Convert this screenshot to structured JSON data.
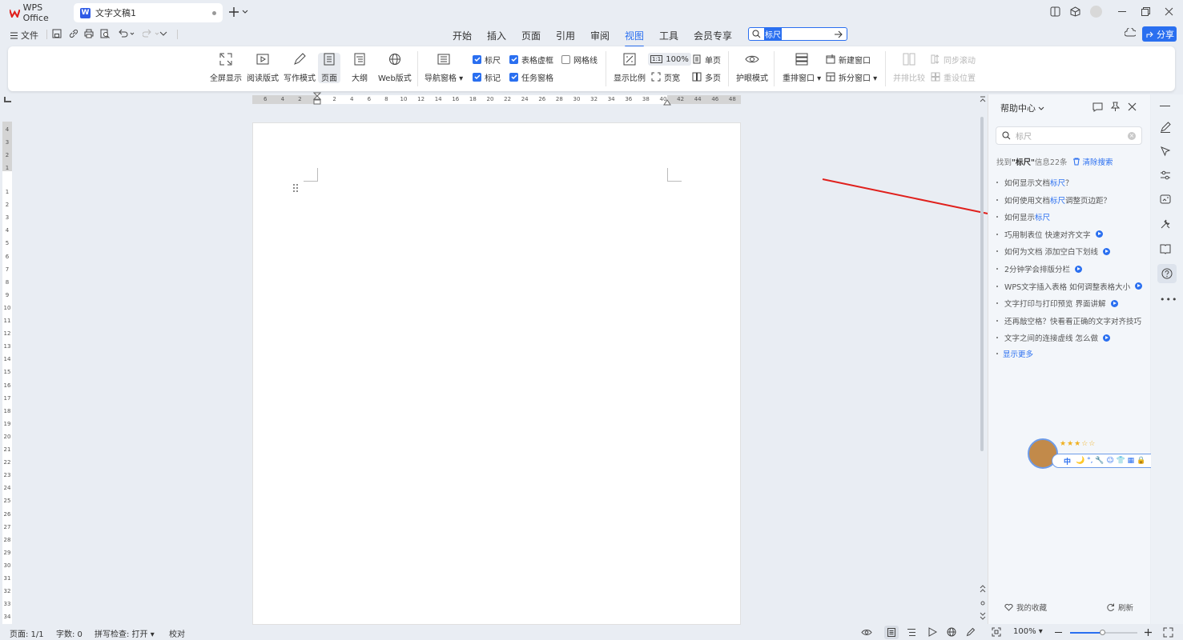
{
  "titlebar": {
    "app_tab": "WPS Office",
    "doc_tab": "文字文稿1",
    "doc_tab_badge": "W"
  },
  "menubar": {
    "file": "文件",
    "tabs": [
      "开始",
      "插入",
      "页面",
      "引用",
      "审阅",
      "视图",
      "工具",
      "会员专享"
    ],
    "active_tab": "视图",
    "search_value": "标尺",
    "share": "分享"
  },
  "ribbon": {
    "fullscreen": "全屏显示",
    "read_mode": "阅读版式",
    "write_mode": "写作模式",
    "page": "页面",
    "outline": "大纲",
    "web": "Web版式",
    "nav_pane": "导航窗格",
    "ruler": "标尺",
    "table_gridlines": "表格虚框",
    "gridlines": "网格线",
    "marks": "标记",
    "task_pane": "任务窗格",
    "zoom": "显示比例",
    "zoom_100": "100%",
    "page_width": "页宽",
    "single_page": "单页",
    "multi_page": "多页",
    "eye_mode": "护眼模式",
    "rearrange": "重排窗口",
    "new_window": "新建窗口",
    "split_window": "拆分窗口",
    "side_by_side": "并排比较",
    "sync_scroll": "同步滚动",
    "reset_position": "重设位置",
    "checkboxes": {
      "ruler": true,
      "table_gridlines": true,
      "gridlines": false,
      "marks": true,
      "task_pane": true
    }
  },
  "ruler": {
    "h_left": [
      "6",
      "4",
      "2"
    ],
    "h_right": [
      "2",
      "4",
      "6",
      "8",
      "10",
      "12",
      "14",
      "16",
      "18",
      "20",
      "22",
      "24",
      "26",
      "28",
      "30",
      "32",
      "34",
      "36",
      "38",
      "40",
      "42",
      "44",
      "46",
      "48"
    ],
    "v_top": [
      "4",
      "3",
      "2",
      "1"
    ],
    "v_bottom": [
      "1",
      "2",
      "3",
      "4",
      "5",
      "6",
      "7",
      "8",
      "9",
      "10",
      "11",
      "12",
      "13",
      "14",
      "15",
      "16",
      "17",
      "18",
      "19",
      "20",
      "21",
      "22",
      "23",
      "24",
      "25",
      "26",
      "27",
      "28",
      "29",
      "30",
      "31",
      "32",
      "33",
      "34"
    ]
  },
  "help": {
    "title": "帮助中心",
    "search_placeholder": "标尺",
    "summary_prefix": "找到",
    "summary_term": "\"标尺\"",
    "summary_suffix": "信息22条",
    "clear_search": "清除搜索",
    "results": [
      {
        "pre": "如何显示文档",
        "hl": "标尺",
        "post": "？",
        "video": false
      },
      {
        "pre": "如何使用文档",
        "hl": "标尺",
        "post": "调整页边距？",
        "video": false
      },
      {
        "pre": "如何显示",
        "hl": "标尺",
        "post": "",
        "video": false
      },
      {
        "pre": "巧用制表位 快速对齐文字",
        "hl": "",
        "post": "",
        "video": true
      },
      {
        "pre": "如何为文档 添加空白下划线",
        "hl": "",
        "post": "",
        "video": true
      },
      {
        "pre": "2分钟学会排版分栏",
        "hl": "",
        "post": "",
        "video": true
      },
      {
        "pre": "WPS文字插入表格 如何调整表格大小",
        "hl": "",
        "post": "",
        "video": true
      },
      {
        "pre": "文字打印与打印预览 界面讲解",
        "hl": "",
        "post": "",
        "video": true
      },
      {
        "pre": "还再敲空格？快看看正确的文字对齐技巧",
        "hl": "",
        "post": "",
        "video": false
      },
      {
        "pre": "文字之间的连接虚线 怎么做",
        "hl": "",
        "post": "",
        "video": true
      }
    ],
    "show_more": "显示更多",
    "favorites": "我的收藏",
    "refresh": "刷新"
  },
  "ime": {
    "label": "中",
    "icons": "🌙 °, 🔧 ☺ 👕 ▦ 🔒"
  },
  "statusbar": {
    "page": "页面: 1/1",
    "words": "字数: 0",
    "spell": "拼写检查: 打开",
    "proof": "校对",
    "zoom": "100%"
  },
  "colors": {
    "accent": "#2a6ff0",
    "arrow": "#e0201c"
  }
}
